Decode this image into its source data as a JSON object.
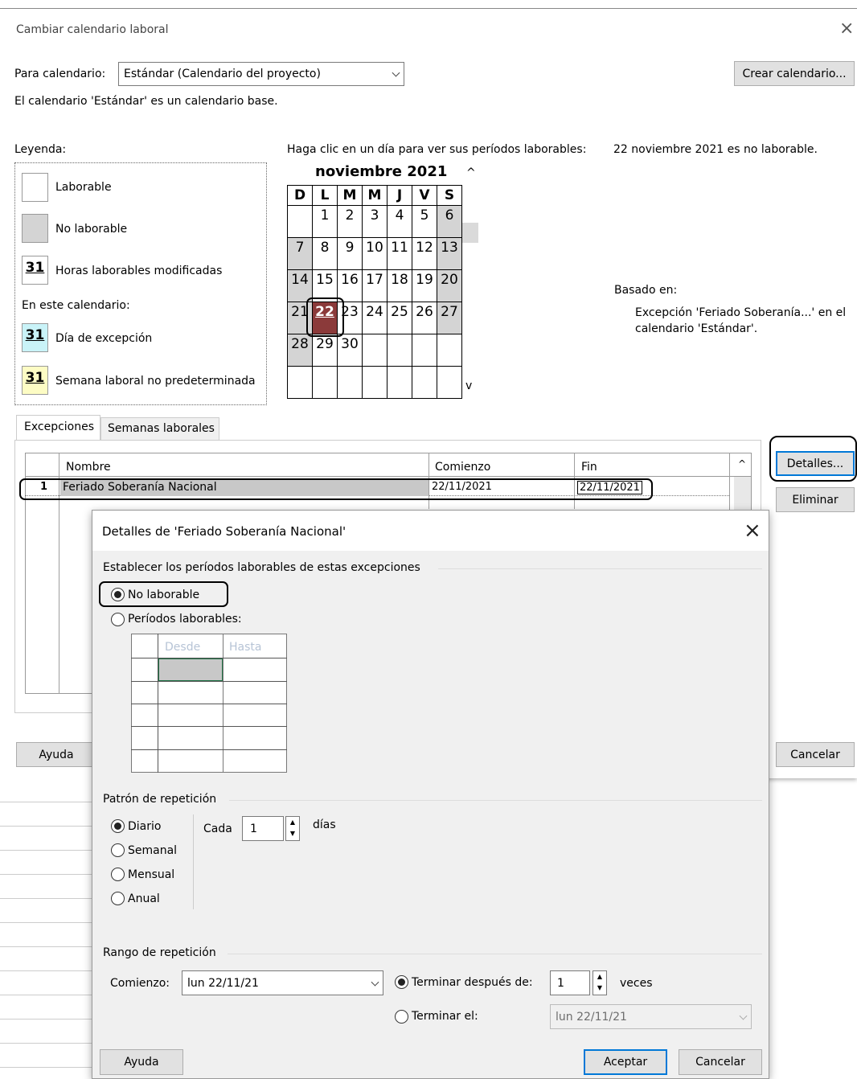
{
  "main_dialog": {
    "title": "Cambiar calendario laboral",
    "para_calendario_label": "Para calendario:",
    "calendar_value": "Estándar (Calendario del proyecto)",
    "create_calendar_button": "Crear calendario...",
    "base_calendar_note": "El calendario 'Estándar' es un calendario base.",
    "legend": {
      "title": "Leyenda:",
      "working": "Laborable",
      "nonworking": "No laborable",
      "modified_hours": "Horas laborables modificadas",
      "in_this_calendar": "En este calendario:",
      "exception_day": "Día de excepción",
      "nondefault_week": "Semana laboral no predeterminada",
      "sample_number": "31"
    },
    "click_instruction": "Haga clic en un día para ver sus períodos laborables:",
    "day_status": "22 noviembre 2021 es no laborable.",
    "month_title": "noviembre 2021",
    "weekday_headers": [
      "D",
      "L",
      "M",
      "M",
      "J",
      "V",
      "S"
    ],
    "calendar_rows": [
      [
        "",
        "1",
        "2",
        "3",
        "4",
        "5",
        "6"
      ],
      [
        "7",
        "8",
        "9",
        "10",
        "11",
        "12",
        "13"
      ],
      [
        "14",
        "15",
        "16",
        "17",
        "18",
        "19",
        "20"
      ],
      [
        "21",
        "22",
        "23",
        "24",
        "25",
        "26",
        "27"
      ],
      [
        "28",
        "29",
        "30",
        "",
        "",
        "",
        ""
      ],
      [
        "",
        "",
        "",
        "",
        "",
        "",
        ""
      ]
    ],
    "based_on_label": "Basado en:",
    "based_on_text": "Excepción 'Feriado Soberanía...' en el calendario 'Estándar'.",
    "tabs": [
      "Excepciones",
      "Semanas laborales"
    ],
    "table_headers": {
      "name": "Nombre",
      "start": "Comienzo",
      "end": "Fin"
    },
    "exception_row": {
      "index": "1",
      "name": "Feriado Soberanía Nacional",
      "start": "22/11/2021",
      "end": "22/11/2021"
    },
    "details_button": "Detalles...",
    "delete_button": "Eliminar",
    "help_button": "Ayuda",
    "cancel_button": "Cancelar"
  },
  "details_dialog": {
    "title": "Detalles de 'Feriado Soberanía Nacional'",
    "section_periods": "Establecer los períodos laborables de estas excepciones",
    "radio_nonworking": "No laborable",
    "radio_working_periods": "Períodos laborables:",
    "periods_headers": [
      "Desde",
      "Hasta"
    ],
    "section_pattern": "Patrón de repetición",
    "pattern_options": [
      "Diario",
      "Semanal",
      "Mensual",
      "Anual"
    ],
    "cada_label": "Cada",
    "cada_value": "1",
    "dias_label": "días",
    "section_range": "Rango de repetición",
    "comienzo_label": "Comienzo:",
    "comienzo_value": "lun 22/11/21",
    "end_after_label": "Terminar después de:",
    "end_after_value": "1",
    "veces_label": "veces",
    "end_on_label": "Terminar el:",
    "end_on_value": "lun 22/11/21",
    "help_button": "Ayuda",
    "accept_button": "Aceptar",
    "cancel_button": "Cancelar"
  },
  "colors": {
    "selected_day": "#8b3a3a",
    "nonworking": "#d4d4d4",
    "exception": "#c9f3f8",
    "nondefault": "#fdfcc4",
    "accent": "#0078d7"
  }
}
